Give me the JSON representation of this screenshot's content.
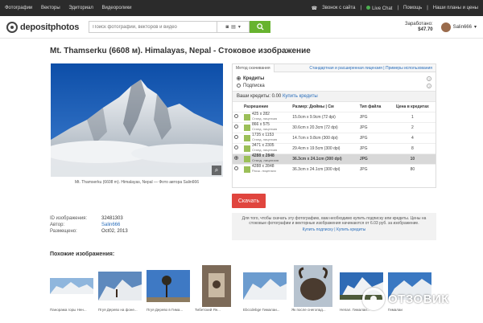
{
  "topbar": {
    "nav": [
      "Фотографии",
      "Векторы",
      "Эдиториал",
      "Видеоролики"
    ],
    "call": "Звонок с сайта",
    "chat": "Live Chat",
    "help": "Помощь",
    "plans": "Наши планы и цены"
  },
  "header": {
    "logo": "depositphotos",
    "search_placeholder": "Поиск фотографий, векторов и видео",
    "earned_label": "Заработано:",
    "earned_value": "$47.70",
    "username": "Salin666"
  },
  "page": {
    "title": "Mt. Thamserku (6608 м). Himalayas, Nepal - Стоковое изображение",
    "caption": "Mt. Thamserku (6608 m). Himalayas, Nepal — Фото автора Salin666"
  },
  "purchase": {
    "tab_label": "Метод скачивания",
    "link_standard": "Стандартная и расширенная лицензия",
    "link_examples": "Примеры использования",
    "radio_credits": "Кредиты",
    "radio_subscription": "Подписка",
    "credits_text": "Ваши кредиты: 0.00",
    "credits_link": "Купить кредиты",
    "columns": [
      "Разрешение",
      "Размер: Дюймы | См",
      "Тип файла",
      "Цена в кредитах"
    ],
    "rows": [
      {
        "res": "425 x 282",
        "lic": "Станд. лицензия",
        "size": "15.0cm x 9.9cm (72 dpi)",
        "type": "JPG",
        "price": "1"
      },
      {
        "res": "866 x 575",
        "lic": "Станд. лицензия",
        "size": "30.6cm x 20.3cm (72 dpi)",
        "type": "JPG",
        "price": "2"
      },
      {
        "res": "1735 x 1153",
        "lic": "Станд. лицензия",
        "size": "14.7cm x 9.8cm (300 dpi)",
        "type": "JPG",
        "price": "4"
      },
      {
        "res": "3471 x 2305",
        "lic": "Станд. лицензия",
        "size": "29.4cm x 19.5cm (300 dpi)",
        "type": "JPG",
        "price": "8"
      },
      {
        "res": "4288 x 2848",
        "lic": "Станд. лицензия",
        "size": "36.3cm x 24.1cm (300 dpi)",
        "type": "JPG",
        "price": "10"
      },
      {
        "res": "4288 x 2848",
        "lic": "Расш. лицензия",
        "size": "36.3cm x 24.1cm (300 dpi)",
        "type": "JPG",
        "price": "80"
      }
    ],
    "buy_label": "Скачать",
    "notice": "Для того, чтобы скачать эту фотографию, вам необходимо купить подписку или кредиты. Цены на стоковые фотографии и векторные изображения начинаются от 6.03 руб. за изображение.",
    "notice_link1": "Купить подписку",
    "notice_link2": "Купить кредиты"
  },
  "meta": {
    "id_label": "ID изображения:",
    "id_value": "32481303",
    "author_label": "Автор:",
    "author_value": "Salin666",
    "date_label": "Размещено:",
    "date_value": "Oct02, 2013"
  },
  "similar": {
    "title": "Похожие изображения:",
    "items": [
      "Панорама горы Нен...",
      "Пгуя Дерево на фоне...",
      "Пгуя Дерево в Гима...",
      "Тибетский Ян...",
      "Ebccdebge Гималаи...",
      "Як после снегопад...",
      "Непал. Гималаи...",
      "Гималаи"
    ]
  },
  "watermark": "ОТЗОВИК"
}
